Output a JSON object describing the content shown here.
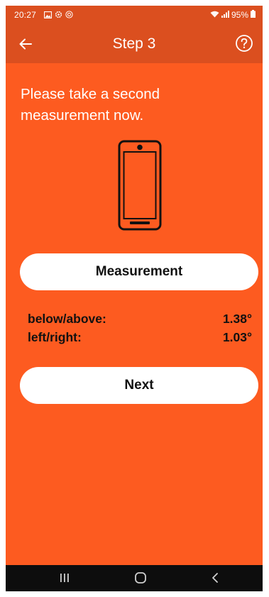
{
  "status_bar": {
    "time": "20:27",
    "left_icons": [
      "image-icon",
      "settings-icon",
      "notification-icon"
    ],
    "battery": "95%"
  },
  "app_bar": {
    "title": "Step 3"
  },
  "main": {
    "instruction": "Please take a second measurement now.",
    "measurement_button_label": "Measurement",
    "readings": [
      {
        "label": "below/above:",
        "value": "1.38°"
      },
      {
        "label": "left/right:",
        "value": "1.03°"
      }
    ],
    "next_button_label": "Next"
  },
  "colors": {
    "background": "#FD5B20",
    "app_bar": "#DB4F1F",
    "button": "#FFFFFF",
    "nav_bar": "#0D0D0D"
  }
}
